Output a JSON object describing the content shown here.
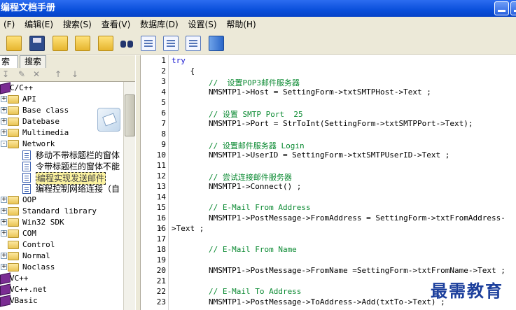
{
  "window": {
    "title": "编程文档手册"
  },
  "menu": [
    "(F)",
    "编辑(E)",
    "搜索(S)",
    "查看(V)",
    "数据库(D)",
    "设置(S)",
    "帮助(H)"
  ],
  "tabs": [
    "索引",
    "搜索"
  ],
  "tree": [
    {
      "label": "C/C++",
      "type": "book",
      "level": 0,
      "expander": "-"
    },
    {
      "label": "API",
      "type": "folder",
      "level": 1,
      "expander": "+"
    },
    {
      "label": "Base class",
      "type": "folder",
      "level": 1,
      "expander": "+"
    },
    {
      "label": "Datebase",
      "type": "folder",
      "level": 1,
      "expander": "+"
    },
    {
      "label": "Multimedia",
      "type": "folder",
      "level": 1,
      "expander": "+"
    },
    {
      "label": "Network",
      "type": "folder",
      "level": 1,
      "expander": "-"
    },
    {
      "label": "移动不带标题栏的窗体",
      "type": "doc",
      "level": 2
    },
    {
      "label": "令带标题栏的窗体不能",
      "type": "doc",
      "level": 2
    },
    {
      "label": "编程实现发送邮件",
      "type": "doc",
      "level": 2,
      "selected": true
    },
    {
      "label": "编程控制网络连接（自",
      "type": "doc",
      "level": 2
    },
    {
      "label": "OOP",
      "type": "folder",
      "level": 1,
      "expander": "+"
    },
    {
      "label": "Standard library",
      "type": "folder",
      "level": 1,
      "expander": "+"
    },
    {
      "label": "Win32 SDK",
      "type": "folder",
      "level": 1,
      "expander": "+"
    },
    {
      "label": "COM",
      "type": "folder",
      "level": 1,
      "expander": "+"
    },
    {
      "label": "Control",
      "type": "folder",
      "level": 1,
      "expander": ""
    },
    {
      "label": "Normal",
      "type": "folder",
      "level": 1,
      "expander": "+"
    },
    {
      "label": "Noclass",
      "type": "folder",
      "level": 1,
      "expander": "+"
    },
    {
      "label": "VC++",
      "type": "book",
      "level": 0,
      "expander": "+"
    },
    {
      "label": "VC++.net",
      "type": "book",
      "level": 0,
      "expander": "+"
    },
    {
      "label": "VBasic",
      "type": "book",
      "level": 0,
      "expander": "+"
    }
  ],
  "code": [
    {
      "n": "1",
      "t": "try",
      "c": "kw"
    },
    {
      "n": "2",
      "t": "    {",
      "c": ""
    },
    {
      "n": "3",
      "t": "        //  设置POP3邮件服务器",
      "c": "cmt"
    },
    {
      "n": "4",
      "t": "        NMSMTP1->Host = SettingForm->txtSMTPHost->Text ;",
      "c": ""
    },
    {
      "n": "5",
      "t": "",
      "c": ""
    },
    {
      "n": "6",
      "t": "        // 设置 SMTP Port  25",
      "c": "cmt"
    },
    {
      "n": "7",
      "t": "        NMSMTP1->Port = StrToInt(SettingForm->txtSMTPPort->Text);",
      "c": ""
    },
    {
      "n": "8",
      "t": "",
      "c": ""
    },
    {
      "n": "9",
      "t": "        // 设置邮件服务器 Login",
      "c": "cmt"
    },
    {
      "n": "10",
      "t": "        NMSMTP1->UserID = SettingForm->txtSMTPUserID->Text ;",
      "c": ""
    },
    {
      "n": "11",
      "t": "",
      "c": ""
    },
    {
      "n": "12",
      "t": "        // 尝试连接邮件服务器",
      "c": "cmt"
    },
    {
      "n": "13",
      "t": "        NMSMTP1->Connect() ;",
      "c": ""
    },
    {
      "n": "14",
      "t": "",
      "c": ""
    },
    {
      "n": "15",
      "t": "        // E-Mail From Address",
      "c": "cmt"
    },
    {
      "n": "16",
      "t": "        NMSMTP1->PostMessage->FromAddress = SettingForm->txtFromAddress-",
      "c": ""
    },
    {
      "n": "16",
      "t": ">Text ;",
      "c": "",
      "wrap": true
    },
    {
      "n": "17",
      "t": "",
      "c": ""
    },
    {
      "n": "18",
      "t": "        // E-Mail From Name",
      "c": "cmt"
    },
    {
      "n": "19",
      "t": "",
      "c": ""
    },
    {
      "n": "20",
      "t": "        NMSMTP1->PostMessage->FromName =SettingForm->txtFromName->Text ;",
      "c": ""
    },
    {
      "n": "21",
      "t": "",
      "c": ""
    },
    {
      "n": "22",
      "t": "        // E-Mail To Address",
      "c": "cmt"
    },
    {
      "n": "23",
      "t": "        NMSMTP1->PostMessage->ToAddress->Add(txtTo->Text) ;",
      "c": ""
    }
  ],
  "watermark": "最需教育"
}
